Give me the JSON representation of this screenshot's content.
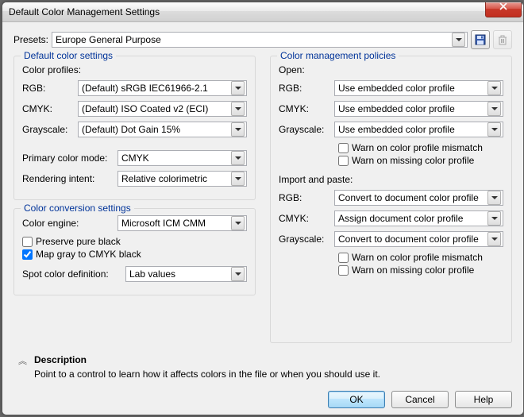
{
  "window": {
    "title": "Default Color Management Settings"
  },
  "presets": {
    "label": "Presets:",
    "value": "Europe General Purpose"
  },
  "left": {
    "group1": {
      "legend": "Default color settings",
      "profiles_head": "Color profiles:",
      "rows": {
        "rgb": {
          "label": "RGB:",
          "value": "(Default) sRGB IEC61966-2.1"
        },
        "cmyk": {
          "label": "CMYK:",
          "value": "(Default) ISO Coated v2 (ECI)"
        },
        "grayscale": {
          "label": "Grayscale:",
          "value": "(Default) Dot Gain 15%"
        }
      },
      "mode": {
        "label": "Primary color mode:",
        "value": "CMYK"
      },
      "intent": {
        "label": "Rendering intent:",
        "value": "Relative colorimetric"
      }
    },
    "group2": {
      "legend": "Color conversion settings",
      "engine": {
        "label": "Color engine:",
        "value": "Microsoft ICM CMM"
      },
      "preserve_black": {
        "label": "Preserve pure black",
        "checked": false
      },
      "map_gray": {
        "label": "Map gray to CMYK black",
        "checked": true
      },
      "spot": {
        "label": "Spot color definition:",
        "value": "Lab values"
      }
    }
  },
  "right": {
    "legend": "Color management policies",
    "open_head": "Open:",
    "open": {
      "rgb": {
        "label": "RGB:",
        "value": "Use embedded color profile"
      },
      "cmyk": {
        "label": "CMYK:",
        "value": "Use embedded color profile"
      },
      "grayscale": {
        "label": "Grayscale:",
        "value": "Use embedded color profile"
      }
    },
    "open_warn_mismatch": {
      "label": "Warn on color profile mismatch",
      "checked": false
    },
    "open_warn_missing": {
      "label": "Warn on missing color profile",
      "checked": false
    },
    "import_head": "Import and paste:",
    "import": {
      "rgb": {
        "label": "RGB:",
        "value": "Convert to document color profile"
      },
      "cmyk": {
        "label": "CMYK:",
        "value": "Assign document color profile"
      },
      "grayscale": {
        "label": "Grayscale:",
        "value": "Convert to document color profile"
      }
    },
    "import_warn_mismatch": {
      "label": "Warn on color profile mismatch",
      "checked": false
    },
    "import_warn_missing": {
      "label": "Warn on missing color profile",
      "checked": false
    }
  },
  "description": {
    "title": "Description",
    "text": "Point to a control to learn how it affects colors in the file or when you should use it."
  },
  "buttons": {
    "ok": "OK",
    "cancel": "Cancel",
    "help": "Help"
  }
}
